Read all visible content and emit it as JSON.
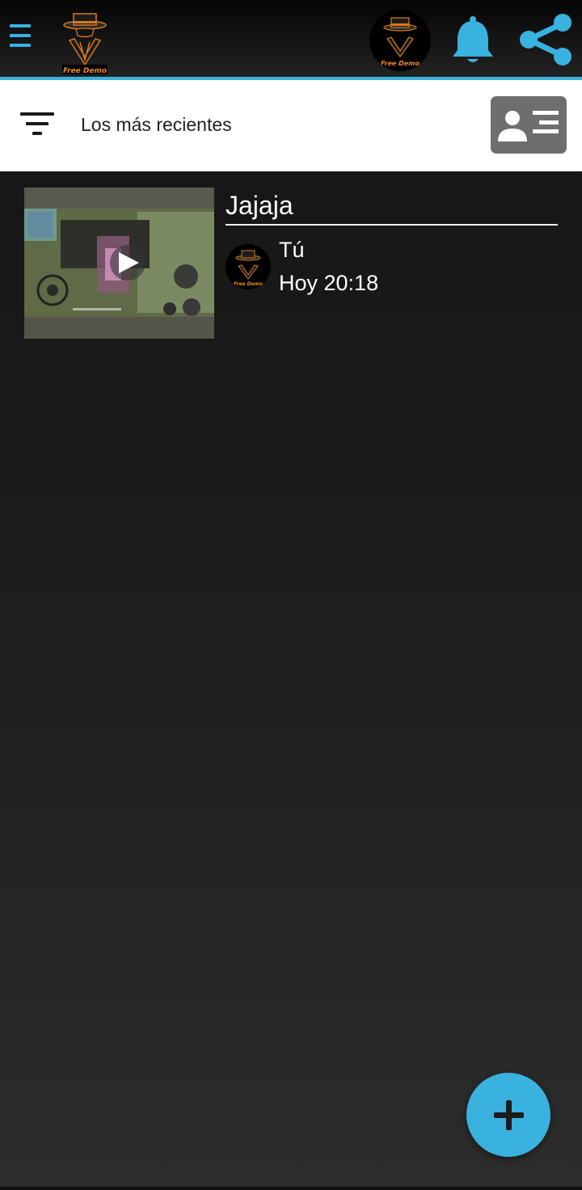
{
  "app": {
    "logo_text": "Free Demo",
    "accent_color": "#39b2e0"
  },
  "toolbar": {
    "menu_icon": "hamburger-menu-icon",
    "notification_icon": "bell-icon",
    "share_icon": "share-icon"
  },
  "filter": {
    "label": "Los más recientes",
    "icon": "filter-sort-icon",
    "profile_card_icon": "contact-card-icon"
  },
  "posts": [
    {
      "title": "Jajaja",
      "author": "Tú",
      "time": "Hoy 20:18",
      "thumbnail": "video-thumbnail",
      "play_icon": "play-icon"
    }
  ],
  "fab": {
    "icon": "plus-icon"
  }
}
